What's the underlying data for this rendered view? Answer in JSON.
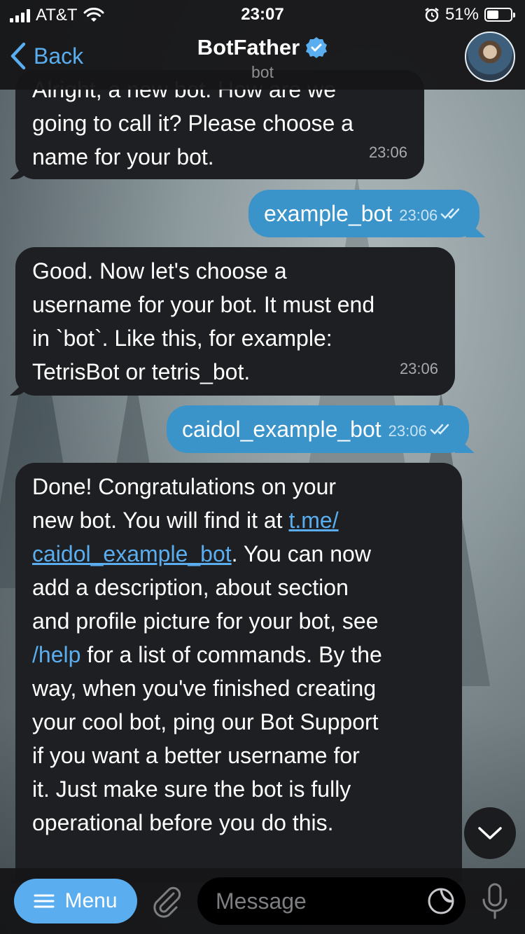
{
  "status_bar": {
    "carrier": "AT&T",
    "time": "23:07",
    "battery": "51%",
    "battery_level": 0.51
  },
  "header": {
    "back_label": "Back",
    "title": "BotFather",
    "subtitle": "bot"
  },
  "messages": [
    {
      "from": "bot",
      "lines": [
        "Alright, a new bot. How are we",
        "going to call it? Please choose a",
        "name for your bot."
      ],
      "time": "23:06"
    },
    {
      "from": "me",
      "text": "example_bot",
      "time": "23:06"
    },
    {
      "from": "bot",
      "lines": [
        "Good. Now let's choose a",
        "username for your bot. It must end",
        "in `bot`. Like this, for example:",
        "TetrisBot or tetris_bot."
      ],
      "time": "23:06"
    },
    {
      "from": "me",
      "text": "caidol_example_bot",
      "time": "23:06"
    },
    {
      "from": "bot",
      "l1": "Done! Congratulations on your",
      "l2": "new bot. You will find it at ",
      "link_part1": "t.me/",
      "link_part2": "caidol_example_bot",
      "l3_rest": ". You can now",
      "l4": "add a description, about section",
      "l5": "and profile picture for your bot, see",
      "help_cmd": "/help",
      "l6_rest": " for a list of commands. By the",
      "l7": "way, when you've finished creating",
      "l8": "your cool bot, ping our Bot Support",
      "l9": "if you want a better username for",
      "l10": "it. Just make sure the bot is fully",
      "l11": "operational before you do this."
    }
  ],
  "bottom_bar": {
    "menu_label": "Menu",
    "message_placeholder": "Message"
  },
  "colors": {
    "accent": "#5aaef0",
    "outgoing_bubble": "#3a93c9",
    "incoming_bubble": "#1e1f22"
  }
}
